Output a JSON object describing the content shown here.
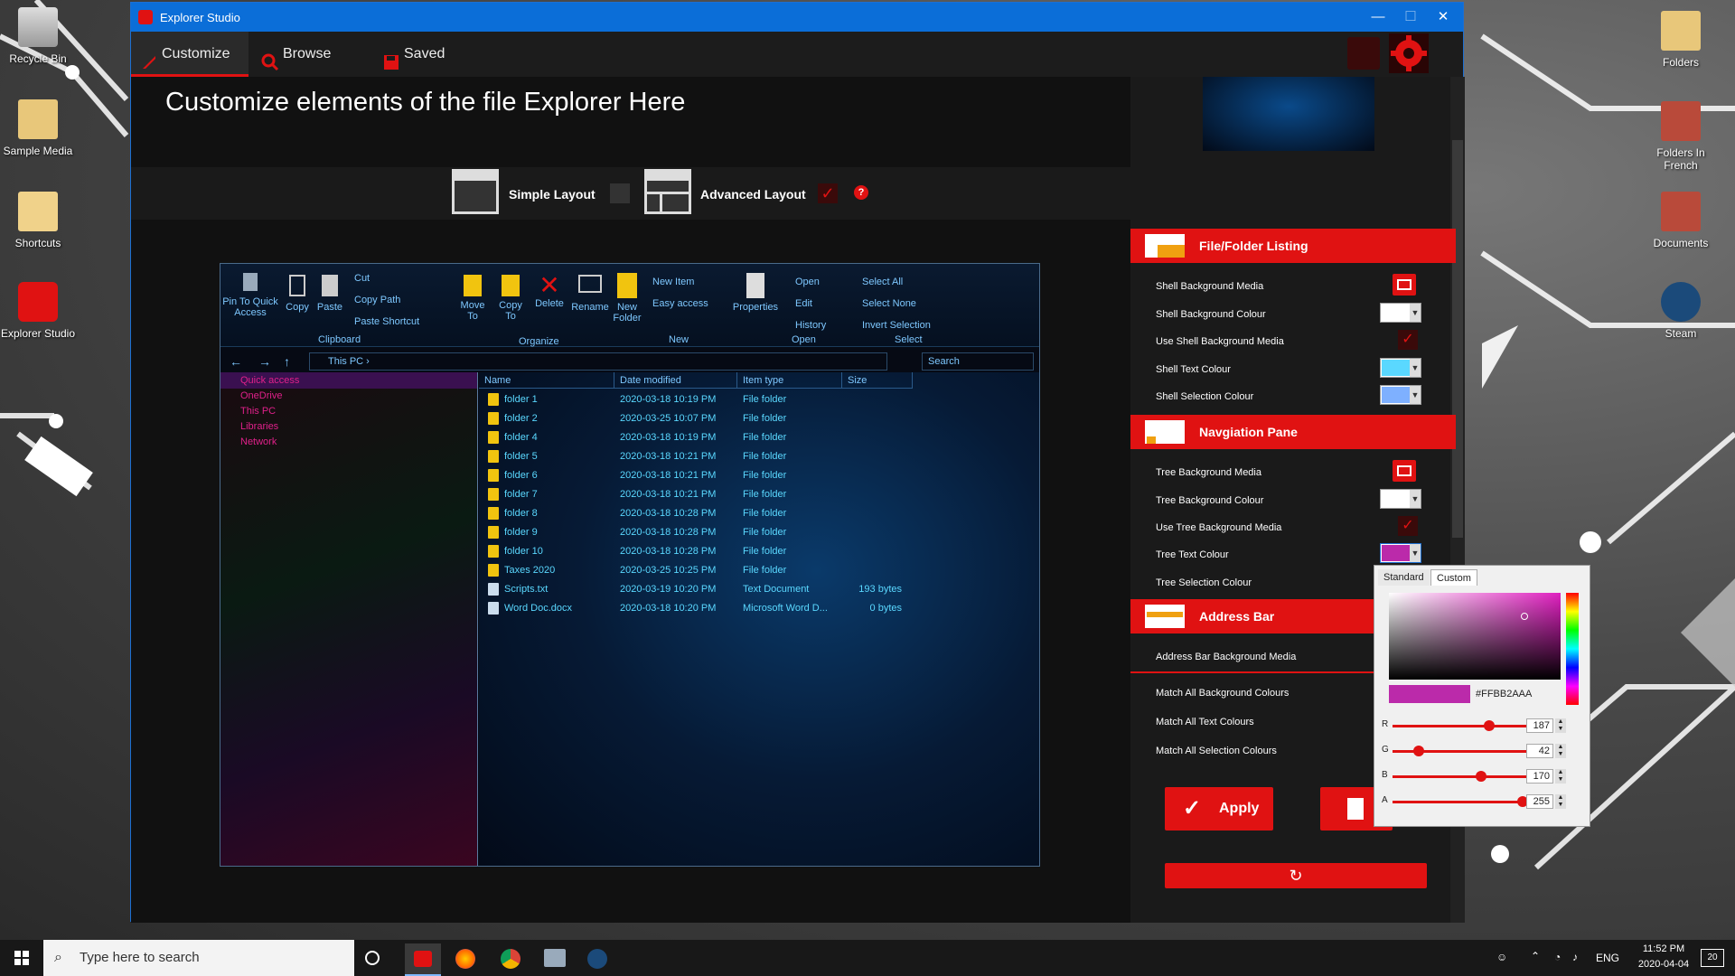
{
  "desktop": {
    "left_icons": [
      "Recycle Bin",
      "Sample Media",
      "Shortcuts",
      "Explorer Studio"
    ],
    "right_icons": [
      "Folders",
      "Folders In French",
      "Documents",
      "Steam"
    ]
  },
  "window": {
    "title": "Explorer Studio",
    "minimize": "—",
    "maximize": "☐",
    "close": "✕"
  },
  "tabs": [
    {
      "label": "Customize",
      "icon": "brush-icon"
    },
    {
      "label": "Browse",
      "icon": "search-icon"
    },
    {
      "label": "Saved",
      "icon": "save-icon"
    }
  ],
  "main": {
    "heading": "Customize elements of the file Explorer Here",
    "simple_layout": "Simple Layout",
    "advanced_layout": "Advanced Layout",
    "advanced_checked": "✓",
    "help": "?"
  },
  "preview": {
    "ribbon": {
      "pin": "Pin To Quick Access",
      "copy": "Copy",
      "paste": "Paste",
      "cut": "Cut",
      "copy_path": "Copy Path",
      "paste_shortcut": "Paste Shortcut",
      "move_to": "Move To",
      "copy_to": "Copy To",
      "delete": "Delete",
      "rename": "Rename",
      "new_folder": "New Folder",
      "new_item": "New Item",
      "easy_access": "Easy access",
      "properties": "Properties",
      "open": "Open",
      "edit": "Edit",
      "history": "History",
      "select_all": "Select All",
      "select_none": "Select None",
      "invert_selection": "Invert Selection",
      "grp_clipboard": "Clipboard",
      "grp_organize": "Organize",
      "grp_new": "New",
      "grp_open": "Open",
      "grp_select": "Select"
    },
    "address": "This PC ›",
    "search": "Search",
    "nav": [
      "Quick access",
      "OneDrive",
      "This PC",
      "Libraries",
      "Network"
    ],
    "columns": [
      "Name",
      "Date modified",
      "Item type",
      "Size"
    ],
    "files": [
      {
        "name": "folder 1",
        "date": "2020-03-18 10:19 PM",
        "type": "File folder",
        "size": ""
      },
      {
        "name": "folder 2",
        "date": "2020-03-25 10:07 PM",
        "type": "File folder",
        "size": ""
      },
      {
        "name": "folder 4",
        "date": "2020-03-18 10:19 PM",
        "type": "File folder",
        "size": ""
      },
      {
        "name": "folder 5",
        "date": "2020-03-18 10:21 PM",
        "type": "File folder",
        "size": ""
      },
      {
        "name": "folder 6",
        "date": "2020-03-18 10:21 PM",
        "type": "File folder",
        "size": ""
      },
      {
        "name": "folder 7",
        "date": "2020-03-18 10:21 PM",
        "type": "File folder",
        "size": ""
      },
      {
        "name": "folder 8",
        "date": "2020-03-18 10:28 PM",
        "type": "File folder",
        "size": ""
      },
      {
        "name": "folder 9",
        "date": "2020-03-18 10:28 PM",
        "type": "File folder",
        "size": ""
      },
      {
        "name": "folder 10",
        "date": "2020-03-18 10:28 PM",
        "type": "File folder",
        "size": ""
      },
      {
        "name": "Taxes 2020",
        "date": "2020-03-25 10:25 PM",
        "type": "File folder",
        "size": ""
      },
      {
        "name": "Scripts.txt",
        "date": "2020-03-19 10:20 PM",
        "type": "Text Document",
        "size": "193 bytes"
      },
      {
        "name": "Word Doc.docx",
        "date": "2020-03-18 10:20 PM",
        "type": "Microsoft Word D...",
        "size": "0 bytes"
      }
    ]
  },
  "side": {
    "sections": [
      {
        "title": "File/Folder Listing",
        "rows": [
          "Shell Background Media",
          "Shell Background Colour",
          "Use Shell Background Media",
          "Shell Text Colour",
          "Shell Selection Colour"
        ]
      },
      {
        "title": "Navgiation Pane",
        "rows": [
          "Tree Background Media",
          "Tree Background Colour",
          "Use Tree Background Media",
          "Tree Text Colour",
          "Tree Selection Colour"
        ]
      },
      {
        "title": "Address Bar",
        "rows": [
          "Address Bar Background Media"
        ]
      }
    ],
    "match_bg": "Match All Background Colours",
    "match_text": "Match All Text Colours",
    "match_sel": "Match All Selection Colours",
    "apply": "Apply",
    "check": "✓",
    "reset_icon": "↻"
  },
  "colour_picker": {
    "tab_standard": "Standard",
    "tab_custom": "Custom",
    "hex": "#FFBB2AAA",
    "r_label": "R",
    "r": "187",
    "g_label": "G",
    "g": "42",
    "b_label": "B",
    "b": "170",
    "a_label": "A",
    "a": "255",
    "r_level": 0.733,
    "g_level": 0.165,
    "b_level": 0.667,
    "a_level": 1.0
  },
  "taskbar": {
    "search_placeholder": "Type here to search",
    "lang": "ENG",
    "time": "11:52 PM",
    "date": "2020-04-04",
    "notifications": "20"
  },
  "colors": {
    "accent": "#e01212",
    "title_blue": "#0b6ed8",
    "shell_text": "#5ad8ff",
    "tree_text": "#bb2aaa"
  }
}
